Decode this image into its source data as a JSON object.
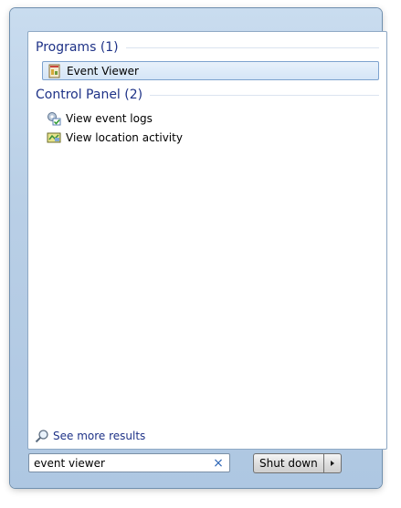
{
  "results": {
    "programs_header": "Programs (1)",
    "programs": [
      {
        "label": "Event Viewer",
        "icon": "event-viewer-icon",
        "selected": true
      }
    ],
    "control_panel_header": "Control Panel (2)",
    "control_panel": [
      {
        "label": "View event logs",
        "icon": "event-logs-icon"
      },
      {
        "label": "View location activity",
        "icon": "location-activity-icon"
      }
    ],
    "see_more": "See more results"
  },
  "search": {
    "value": "event viewer",
    "clear_icon": "×"
  },
  "shutdown": {
    "label": "Shut down"
  }
}
